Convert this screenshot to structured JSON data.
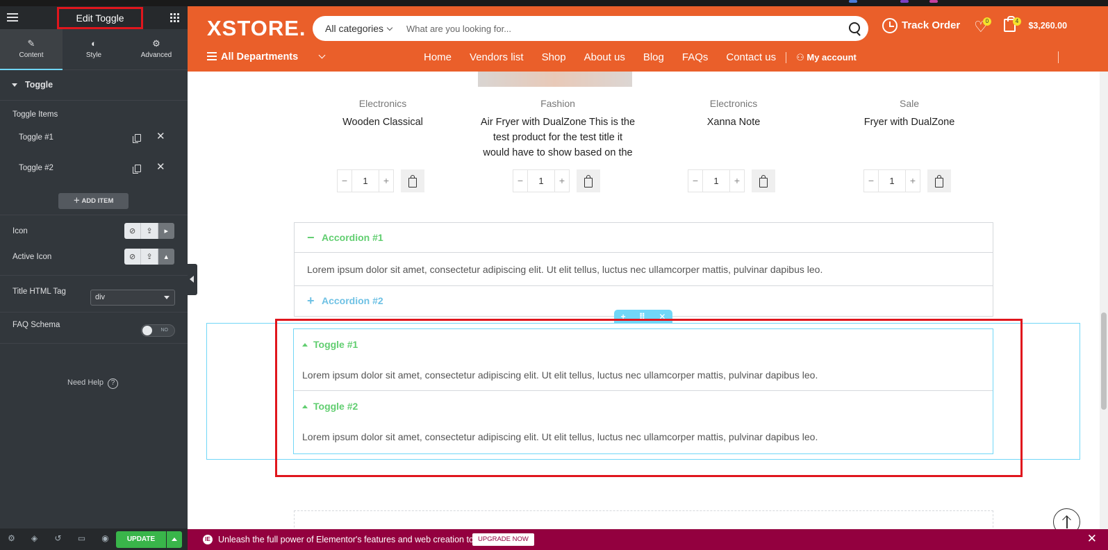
{
  "panel": {
    "title": "Edit Toggle",
    "tabs": [
      {
        "label": "Content",
        "icon": "pencil-icon"
      },
      {
        "label": "Style",
        "icon": "contrast-icon"
      },
      {
        "label": "Advanced",
        "icon": "gear-icon"
      }
    ],
    "section_title": "Toggle",
    "toggle_items_label": "Toggle Items",
    "items": [
      {
        "label": "Toggle #1"
      },
      {
        "label": "Toggle #2"
      }
    ],
    "add_item_label": "ADD ITEM",
    "icon_label": "Icon",
    "active_icon_label": "Active Icon",
    "title_tag_label": "Title HTML Tag",
    "title_tag_value": "div",
    "faq_label": "FAQ Schema",
    "faq_state": "NO",
    "need_help": "Need Help",
    "update_label": "UPDATE",
    "accent": "#71d7f7",
    "update_color": "#39b54a"
  },
  "header": {
    "logo": "XSTORE.",
    "search_category": "All categories",
    "search_placeholder": "What are you looking for...",
    "track_order": "Track Order",
    "wishlist_count": "0",
    "cart_count": "4",
    "cart_total": "$3,260.00",
    "departments": "All Departments",
    "nav": [
      "Home",
      "Vendors list",
      "Shop",
      "About us",
      "Blog",
      "FAQs",
      "Contact us"
    ],
    "account": "My account",
    "brand_color": "#ea5f2a"
  },
  "products": [
    {
      "category": "Electronics",
      "name": "Wooden Classical",
      "qty": "1"
    },
    {
      "category": "Fashion",
      "name": "Air Fryer with DualZone This is the test product for the test title it would have to show based on the",
      "qty": "1"
    },
    {
      "category": "Electronics",
      "name": "Xanna Note",
      "qty": "1"
    },
    {
      "category": "Sale",
      "name": "Fryer with DualZone",
      "qty": "1"
    }
  ],
  "accordion": {
    "items": [
      {
        "title": "Accordion #1",
        "content": "Lorem ipsum dolor sit amet, consectetur adipiscing elit. Ut elit tellus, luctus nec ullamcorper mattis, pulvinar dapibus leo.",
        "color": "#61ce70"
      },
      {
        "title": "Accordion #2",
        "color": "#6ec1e4"
      }
    ]
  },
  "toggle": {
    "items": [
      {
        "title": "Toggle #1",
        "content": "Lorem ipsum dolor sit amet, consectetur adipiscing elit. Ut elit tellus, luctus nec ullamcorper mattis, pulvinar dapibus leo."
      },
      {
        "title": "Toggle #2",
        "content": "Lorem ipsum dolor sit amet, consectetur adipiscing elit. Ut elit tellus, luctus nec ullamcorper mattis, pulvinar dapibus leo."
      }
    ],
    "title_color": "#61ce70"
  },
  "promo": {
    "message": "Unleash the full power of Elementor's features and web creation tools.",
    "button": "UPGRADE NOW",
    "color": "#93003f"
  }
}
